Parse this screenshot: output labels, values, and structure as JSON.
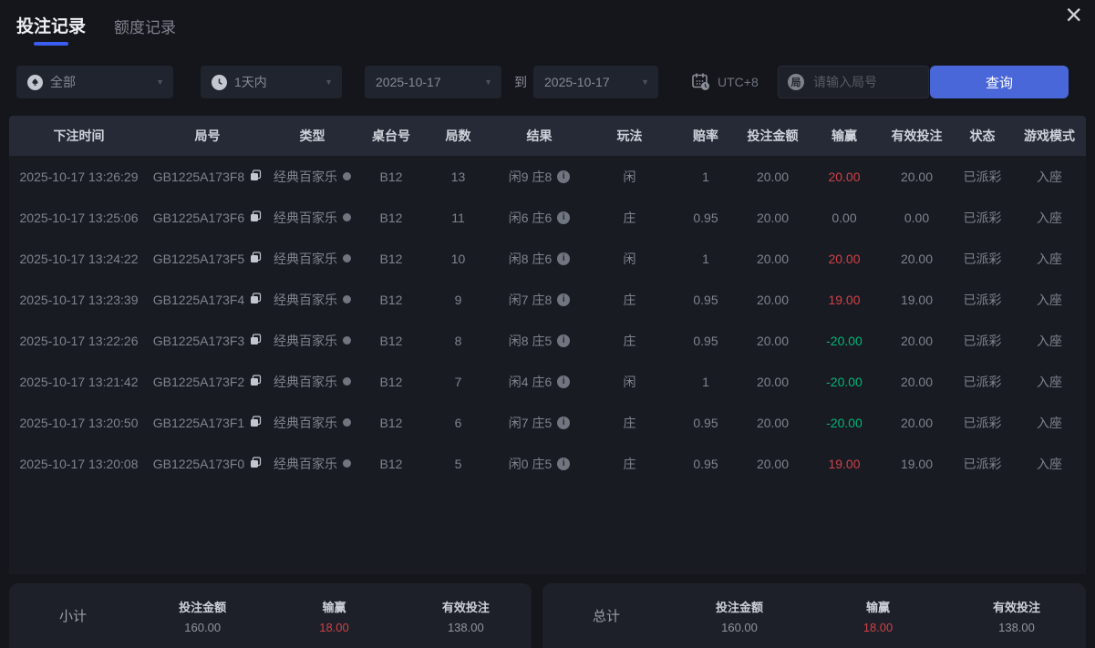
{
  "window": {
    "close_icon": "×"
  },
  "tabs": [
    {
      "label": "投注记录",
      "active": true
    },
    {
      "label": "额度记录",
      "active": false
    }
  ],
  "filters": {
    "game_type": {
      "value": "全部",
      "icon": "spade-icon"
    },
    "time_range": {
      "value": "1天内",
      "icon": "clock-icon"
    },
    "date_from": "2025-10-17",
    "date_to_label": "到",
    "date_to": "2025-10-17",
    "timezone": "UTC+8",
    "round_icon_glyph": "局",
    "round_placeholder": "请输入局号",
    "query_button": "查询",
    "caret_glyph": "▼"
  },
  "table": {
    "headers": [
      "下注时间",
      "局号",
      "类型",
      "桌台号",
      "局数",
      "结果",
      "玩法",
      "赔率",
      "投注金额",
      "输赢",
      "有效投注",
      "状态",
      "游戏模式"
    ],
    "rows": [
      {
        "time": "2025-10-17 13:26:29",
        "round_id": "GB1225A173F8",
        "game_type": "经典百家乐",
        "table_no": "B12",
        "rounds": "13",
        "result": "闲9 庄8",
        "play": "闲",
        "odds": "1",
        "bet_amount": "20.00",
        "win_loss": "20.00",
        "win_loss_color": "red",
        "valid_bet": "20.00",
        "status": "已派彩",
        "mode": "入座"
      },
      {
        "time": "2025-10-17 13:25:06",
        "round_id": "GB1225A173F6",
        "game_type": "经典百家乐",
        "table_no": "B12",
        "rounds": "11",
        "result": "闲6 庄6",
        "play": "庄",
        "odds": "0.95",
        "bet_amount": "20.00",
        "win_loss": "0.00",
        "win_loss_color": "neutral",
        "valid_bet": "0.00",
        "status": "已派彩",
        "mode": "入座"
      },
      {
        "time": "2025-10-17 13:24:22",
        "round_id": "GB1225A173F5",
        "game_type": "经典百家乐",
        "table_no": "B12",
        "rounds": "10",
        "result": "闲8 庄6",
        "play": "闲",
        "odds": "1",
        "bet_amount": "20.00",
        "win_loss": "20.00",
        "win_loss_color": "red",
        "valid_bet": "20.00",
        "status": "已派彩",
        "mode": "入座"
      },
      {
        "time": "2025-10-17 13:23:39",
        "round_id": "GB1225A173F4",
        "game_type": "经典百家乐",
        "table_no": "B12",
        "rounds": "9",
        "result": "闲7 庄8",
        "play": "庄",
        "odds": "0.95",
        "bet_amount": "20.00",
        "win_loss": "19.00",
        "win_loss_color": "red",
        "valid_bet": "19.00",
        "status": "已派彩",
        "mode": "入座"
      },
      {
        "time": "2025-10-17 13:22:26",
        "round_id": "GB1225A173F3",
        "game_type": "经典百家乐",
        "table_no": "B12",
        "rounds": "8",
        "result": "闲8 庄5",
        "play": "庄",
        "odds": "0.95",
        "bet_amount": "20.00",
        "win_loss": "-20.00",
        "win_loss_color": "green",
        "valid_bet": "20.00",
        "status": "已派彩",
        "mode": "入座"
      },
      {
        "time": "2025-10-17 13:21:42",
        "round_id": "GB1225A173F2",
        "game_type": "经典百家乐",
        "table_no": "B12",
        "rounds": "7",
        "result": "闲4 庄6",
        "play": "闲",
        "odds": "1",
        "bet_amount": "20.00",
        "win_loss": "-20.00",
        "win_loss_color": "green",
        "valid_bet": "20.00",
        "status": "已派彩",
        "mode": "入座"
      },
      {
        "time": "2025-10-17 13:20:50",
        "round_id": "GB1225A173F1",
        "game_type": "经典百家乐",
        "table_no": "B12",
        "rounds": "6",
        "result": "闲7 庄5",
        "play": "庄",
        "odds": "0.95",
        "bet_amount": "20.00",
        "win_loss": "-20.00",
        "win_loss_color": "green",
        "valid_bet": "20.00",
        "status": "已派彩",
        "mode": "入座"
      },
      {
        "time": "2025-10-17 13:20:08",
        "round_id": "GB1225A173F0",
        "game_type": "经典百家乐",
        "table_no": "B12",
        "rounds": "5",
        "result": "闲0 庄5",
        "play": "庄",
        "odds": "0.95",
        "bet_amount": "20.00",
        "win_loss": "19.00",
        "win_loss_color": "red",
        "valid_bet": "19.00",
        "status": "已派彩",
        "mode": "入座"
      }
    ]
  },
  "summary": {
    "subtotal": {
      "label": "小计",
      "items": [
        {
          "label": "投注金额",
          "value": "160.00",
          "color": "neutral"
        },
        {
          "label": "输赢",
          "value": "18.00",
          "color": "red"
        },
        {
          "label": "有效投注",
          "value": "138.00",
          "color": "neutral"
        }
      ]
    },
    "total": {
      "label": "总计",
      "items": [
        {
          "label": "投注金额",
          "value": "160.00",
          "color": "neutral"
        },
        {
          "label": "输赢",
          "value": "18.00",
          "color": "red"
        },
        {
          "label": "有效投注",
          "value": "138.00",
          "color": "neutral"
        }
      ]
    }
  },
  "colors": {
    "accent_blue": "#4a67da",
    "tab_underline": "#3a5ef2",
    "win_red": "#cf4149",
    "loss_green": "#00b578"
  }
}
